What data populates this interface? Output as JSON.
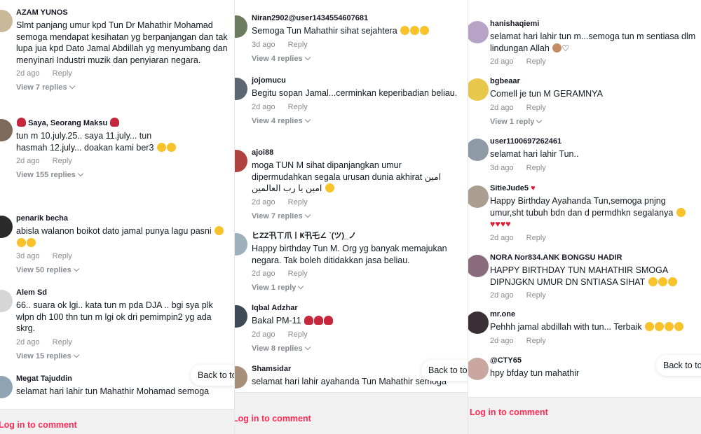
{
  "colors": {
    "accent": "#fe2c55",
    "muted": "#8a8b91",
    "text": "#161823",
    "footer_bg": "#f1f1f2"
  },
  "labels": {
    "reply": "Reply",
    "login": "Log in to comment",
    "back_to_top": "Back to top"
  },
  "panels": [
    {
      "comments": [
        {
          "user": "AZAM YUNOS",
          "text": "Slmt panjang umur kpd Tun Dr Mahathir Mohamad semoga mendapat kesihatan yg berpanjangan dan tak lupa jua kpd Dato Jamal Abdillah yg menyumbang dan menyinari Industri muzik dan penyiaran negara.",
          "time": "2d ago",
          "view": "View 7 replies",
          "avatar": "#c9b79a"
        },
        {
          "user": "Saya, Seorang Maksu",
          "text": "tun m 10.july.25.. saya 11.july... tun hasmah 12.july... doakan kami ber3",
          "time": "2d ago",
          "view": "View 155 replies",
          "avatar": "#7d6a5a"
        },
        {
          "user": "penarik becha",
          "text": "abisla walanon boikot dato jamal punya lagu pasni",
          "time": "3d ago",
          "view": "View 50 replies",
          "avatar": "#2b2b2b"
        },
        {
          "user": "Alem Sd",
          "text": "66.. suara ok lgi.. kata tun m pda DJA .. bgi sya plk wlpn dh 100 thn tun m lgi ok dri pemimpin2 yg ada skrg.",
          "time": "2d ago",
          "view": "View 15 replies",
          "avatar": "#d6d6d6"
        },
        {
          "user": "Megat Tajuddin",
          "text": "selamat hari lahir tun Mahathir Mohamad semoga",
          "time": "",
          "view": "",
          "avatar": "#8fa3b5"
        }
      ]
    },
    {
      "comments": [
        {
          "user": "Niran2902@user1434554607681",
          "text": "Semoga Tun Mahathir sihat sejahtera",
          "time": "3d ago",
          "view": "View 4 replies",
          "avatar": "#6d7b5e"
        },
        {
          "user": "jojomucu",
          "text": "Begitu sopan Jamal...cerminkan keperibadian beliau.",
          "time": "2d ago",
          "view": "View 4 replies",
          "avatar": "#5c6670"
        },
        {
          "user": "ajoi88",
          "text": "moga TUN M sihat dipanjangkan umur dipermudahkan segala urusan dunia akhirat امين امين يا رب العالمين",
          "time": "2d ago",
          "view": "View 7 replies",
          "avatar": "#b0413e"
        },
        {
          "user": "ヒZZ卂ㄒ爪丨Ҝ卂乇∠ ˋ(ツ)_ノ",
          "text": "Happy birthday Tun M. Org yg banyak memajukan negara. Tak boleh ditidakkan jasa beliau.",
          "time": "2d ago",
          "view": "View 1 reply",
          "avatar": "#9fb0bd"
        },
        {
          "user": "Iqbal Adzhar",
          "text": "Bakal PM-11",
          "time": "2d ago",
          "view": "View 8 replies",
          "avatar": "#3e4a55"
        },
        {
          "user": "Shamsidar",
          "text": "selamat hari lahir ayahanda Tun Mahathir semoga",
          "time": "",
          "view": "",
          "avatar": "#a88f7a"
        }
      ]
    },
    {
      "comments": [
        {
          "user": "hanishaqiemi",
          "text": "selamat hari lahir tun m...semoga tun m sentiasa dlm lindungan Allah",
          "time": "2d ago",
          "view": "",
          "avatar": "#b7a3c6"
        },
        {
          "user": "bgbeaar",
          "text": "Comell je tun M GERAMNYA",
          "time": "2d ago",
          "view": "View 1 reply",
          "avatar": "#e8c84a"
        },
        {
          "user": "user1100697262461",
          "text": "selamat hari lahir Tun..",
          "time": "3d ago",
          "view": "",
          "avatar": "#8e9aa6"
        },
        {
          "user": "SitieJude5",
          "text": "Happy Birthday Ayahanda Tun,semoga pnjng umur,sht tubuh bdn dan d permdhkn segalanya",
          "time": "2d ago",
          "view": "",
          "avatar": "#a99e8f"
        },
        {
          "user": "NORA Nor834.ANK BONGSU HADIR",
          "text": "HAPPY BIRTHDAY TUN MAHATHIR SMOGA DIPNJGKN UMUR DN SNTIASA SIHAT",
          "time": "2d ago",
          "view": "",
          "avatar": "#8a6b7c"
        },
        {
          "user": "mr.one",
          "text": "Pehhh jamal abdillah with tun... Terbaik",
          "time": "2d ago",
          "view": "",
          "avatar": "#3a2f35"
        },
        {
          "user": "@CTY65",
          "text": "hpy bfday tun mahathir",
          "time": "",
          "view": "",
          "avatar": "#c9a7a0"
        }
      ]
    }
  ]
}
